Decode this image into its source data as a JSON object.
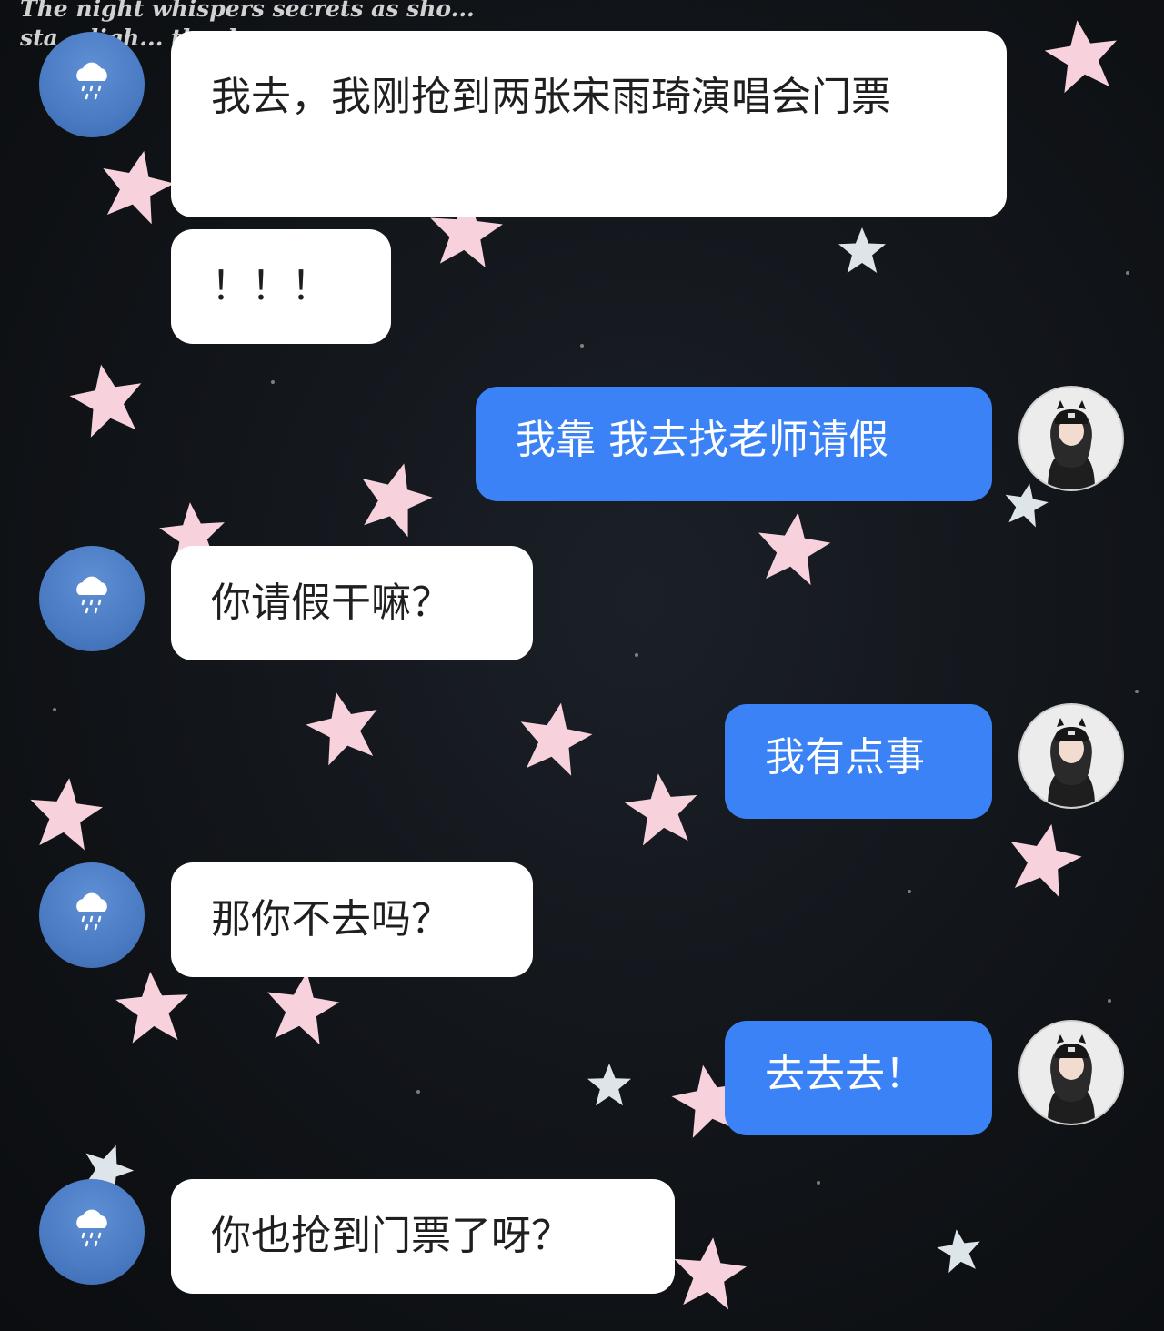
{
  "background": {
    "caption": "The night whispers secrets as sho... sta... ligh... the da..."
  },
  "messages": [
    {
      "side": "left",
      "text": "我去，我刚抢到两张宋雨琦演唱会门票",
      "avatar": "rain-cloud-icon"
    },
    {
      "side": "left",
      "text": "！！！"
    },
    {
      "side": "right",
      "text": "我靠 我去找老师请假",
      "avatar": "girl-photo"
    },
    {
      "side": "left",
      "text": "你请假干嘛？",
      "avatar": "rain-cloud-icon"
    },
    {
      "side": "right",
      "text": "我有点事",
      "avatar": "girl-photo"
    },
    {
      "side": "left",
      "text": "那你不去吗？",
      "avatar": "rain-cloud-icon"
    },
    {
      "side": "right",
      "text": "去去去！",
      "avatar": "girl-photo"
    },
    {
      "side": "left",
      "text": "你也抢到门票了呀？",
      "avatar": "rain-cloud-icon"
    }
  ],
  "colors": {
    "background": "#111418",
    "incoming_bubble": "#ffffff",
    "outgoing_bubble": "#3a82f6",
    "left_avatar": "#4a7bc3",
    "star_pink": "#f7d2dc"
  }
}
